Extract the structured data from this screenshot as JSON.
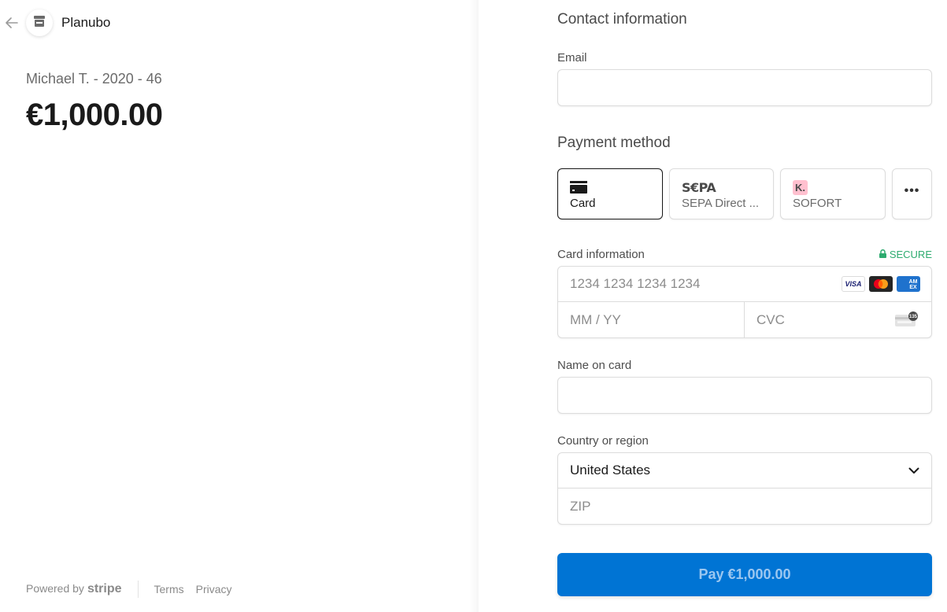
{
  "header": {
    "back_icon": "arrow-left-icon",
    "merchant_logo_icon": "store-icon",
    "merchant_name": "Planubo"
  },
  "summary": {
    "product_name": "Michael T. - 2020 - 46",
    "amount": "€1,000.00"
  },
  "footer": {
    "powered_by": "Powered by",
    "brand": "stripe",
    "links": [
      "Terms",
      "Privacy"
    ]
  },
  "contact": {
    "title": "Contact information",
    "email_label": "Email",
    "email_value": ""
  },
  "payment": {
    "title": "Payment method",
    "methods": [
      {
        "label": "Card",
        "icon": "credit-card-icon",
        "active": true
      },
      {
        "label": "SEPA Direct ...",
        "icon": "sepa-logo",
        "logo_text": "S€PA",
        "active": false
      },
      {
        "label": "SOFORT",
        "icon": "klarna-logo",
        "logo_text": "K.",
        "active": false
      },
      {
        "label": "",
        "icon": "more-dots-icon",
        "logo_text": "•••",
        "active": false
      }
    ]
  },
  "card_info": {
    "label": "Card information",
    "secure_label": "SECURE",
    "number_placeholder": "1234 1234 1234 1234",
    "expiry_placeholder": "MM / YY",
    "cvc_placeholder": "CVC",
    "cvc_icon_text": "135",
    "brands": [
      "VISA",
      "Mastercard",
      "AMEX"
    ]
  },
  "name": {
    "label": "Name on card",
    "value": ""
  },
  "country": {
    "label": "Country or region",
    "selected": "United States",
    "zip_placeholder": "ZIP"
  },
  "pay_button": {
    "label": "Pay €1,000.00"
  },
  "colors": {
    "accent": "#0074d4",
    "secure": "#2dab6f",
    "klarna_pink": "#ffc0cf"
  }
}
